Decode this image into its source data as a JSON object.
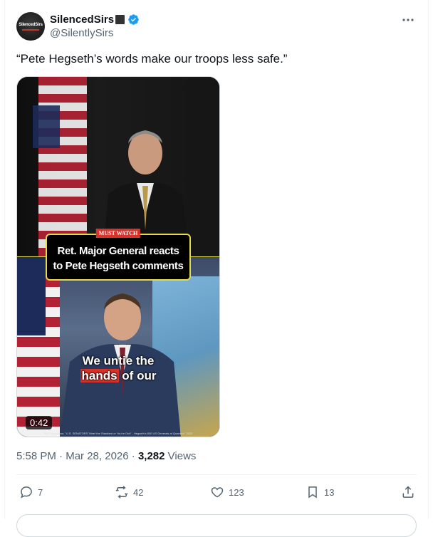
{
  "tweet": {
    "display_name": "SilencedSirs",
    "handle": "@SilentlySirs",
    "avatar_text": "SilencedSirs",
    "text": "“Pete Hegseth’s words make our troops less safe.”",
    "media": {
      "badge": "MUST WATCH",
      "headline_line1": "Ret. Major General reacts",
      "headline_line2": "to Pete Hegseth comments",
      "caption_line1": "We untie the",
      "caption_line2_highlight": "hands",
      "caption_line2_rest": " of our",
      "duration": "0:42",
      "credit": "PBS NewsHour, \"U.S. SENATORS 'Meet the Standard or You're Out!' - Hegseth's 800 US Generals at Quantico\" 2025"
    },
    "time": "5:58 PM",
    "date": "Mar 28, 2026",
    "views_count": "3,282",
    "views_label": "Views",
    "reply_count": "7",
    "repost_count": "42",
    "like_count": "123",
    "bookmark_count": "13"
  },
  "colors": {
    "verified": "#1d9bf0",
    "text_secondary": "#536471",
    "highlight_red": "#d9322a",
    "banner_border": "#e6d94a"
  }
}
